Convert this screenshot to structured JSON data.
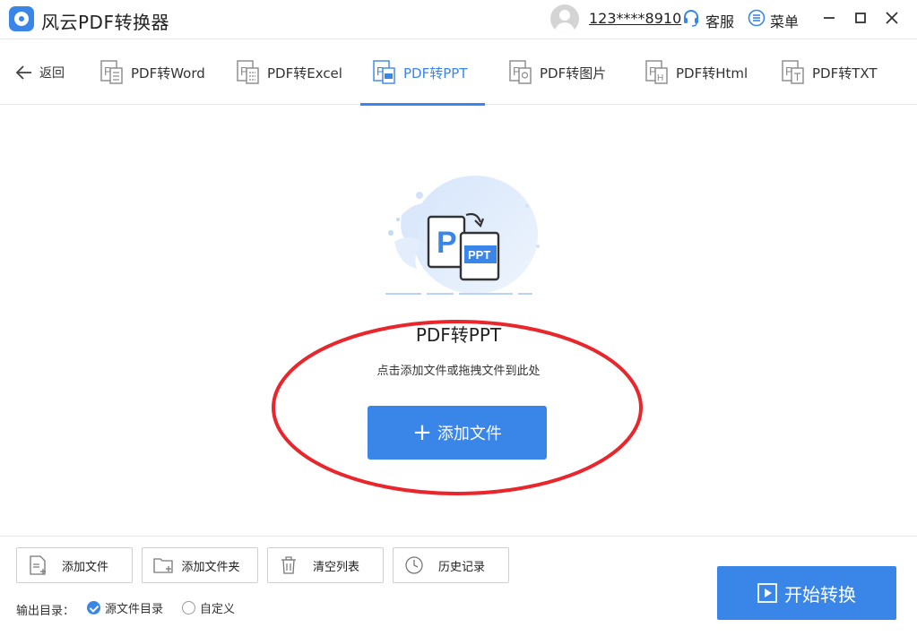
{
  "app": {
    "title": "风云PDF转换器"
  },
  "user": {
    "phone": "123****8910",
    "service_label": "客服",
    "menu_label": "菜单"
  },
  "nav": {
    "back_label": "返回",
    "tabs": [
      {
        "label": "PDF转Word",
        "icon": "pdf-word-icon"
      },
      {
        "label": "PDF转Excel",
        "icon": "pdf-excel-icon"
      },
      {
        "label": "PDF转PPT",
        "icon": "pdf-ppt-icon",
        "active": true
      },
      {
        "label": "PDF转图片",
        "icon": "pdf-image-icon"
      },
      {
        "label": "PDF转Html",
        "icon": "pdf-html-icon"
      },
      {
        "label": "PDF转TXT",
        "icon": "pdf-txt-icon"
      }
    ]
  },
  "main": {
    "illustration": {
      "doc_letter": "P",
      "badge": "PPT"
    },
    "title": "PDF转PPT",
    "hint": "点击添加文件或拖拽文件到此处",
    "add_button": "添加文件"
  },
  "toolbar": {
    "add_file": "添加文件",
    "add_folder": "添加文件夹",
    "clear_list": "清空列表",
    "history": "历史记录"
  },
  "output": {
    "label": "输出目录：",
    "options": [
      {
        "label": "源文件目录",
        "checked": true
      },
      {
        "label": "自定义",
        "checked": false
      }
    ]
  },
  "start_button": "开始转换",
  "colors": {
    "accent": "#3a86e8",
    "annotation": "#e8262b"
  }
}
